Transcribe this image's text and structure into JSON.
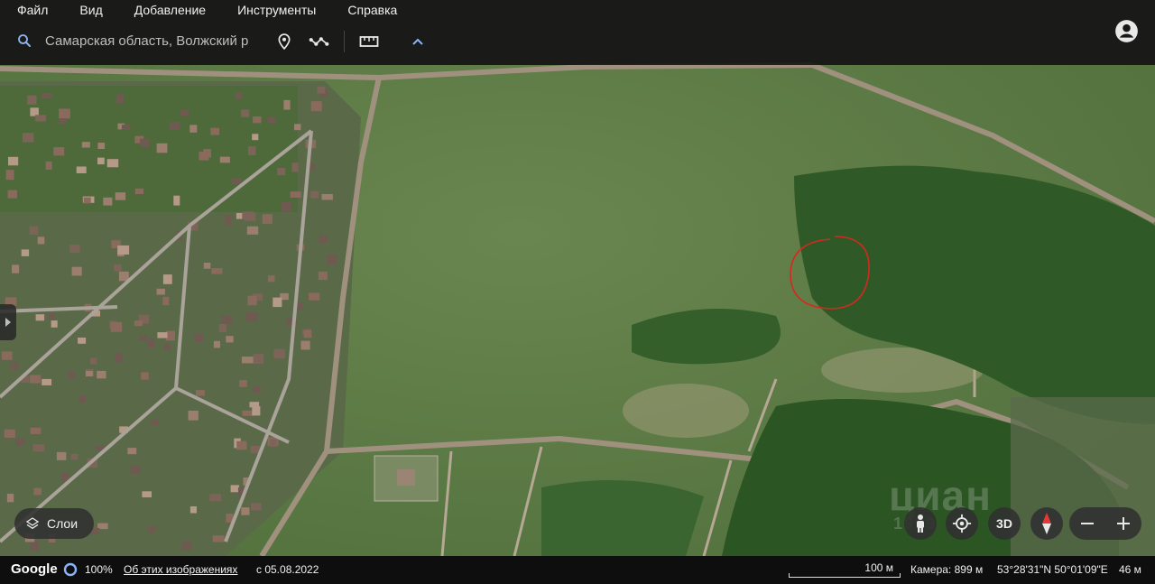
{
  "menu": {
    "items": [
      "Файл",
      "Вид",
      "Добавление",
      "Инструменты",
      "Справка"
    ]
  },
  "search": {
    "value": "Самарская область, Волжский р"
  },
  "toolbar": {
    "icons": [
      "place-marker-icon",
      "path-icon",
      "ruler-icon",
      "chevron-up-icon"
    ]
  },
  "layers": {
    "label": "Слои"
  },
  "map_controls": {
    "three_d_label": "3D"
  },
  "watermark": {
    "text": "циан",
    "number": "1999"
  },
  "status": {
    "brand": "Google",
    "progress_percent": "100%",
    "about_link": "Об этих изображениях",
    "date": "с 05.08.2022",
    "scale_label": "100 м",
    "camera": "Камера: 899 м",
    "coordinates": "53°28'31\"N 50°01'09\"E",
    "elevation": "46 м"
  },
  "colors": {
    "topbar": "#181818",
    "statusbar": "#0e0e0e",
    "field": "#5f7c45",
    "forest": "#2e5a25",
    "road": "#9c8c7a",
    "annotation": "#d42a1e"
  }
}
